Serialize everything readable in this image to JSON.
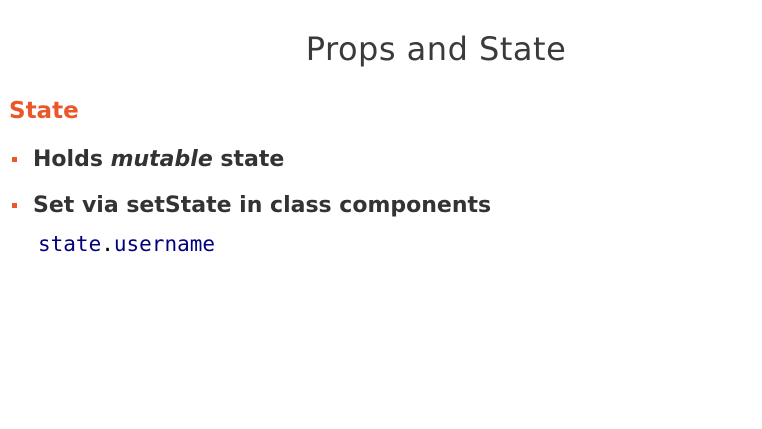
{
  "slide": {
    "title": "Props and State",
    "section_heading": "State",
    "bullets": [
      {
        "prefix": "Holds ",
        "emphasis": "mutable",
        "suffix": " state"
      },
      {
        "text": "Set via setState in class components"
      }
    ],
    "code": {
      "object": "state",
      "separator": ".",
      "property": "username"
    }
  },
  "colors": {
    "accent": "#e9572a",
    "text": "#333333",
    "code": "#00007f"
  }
}
